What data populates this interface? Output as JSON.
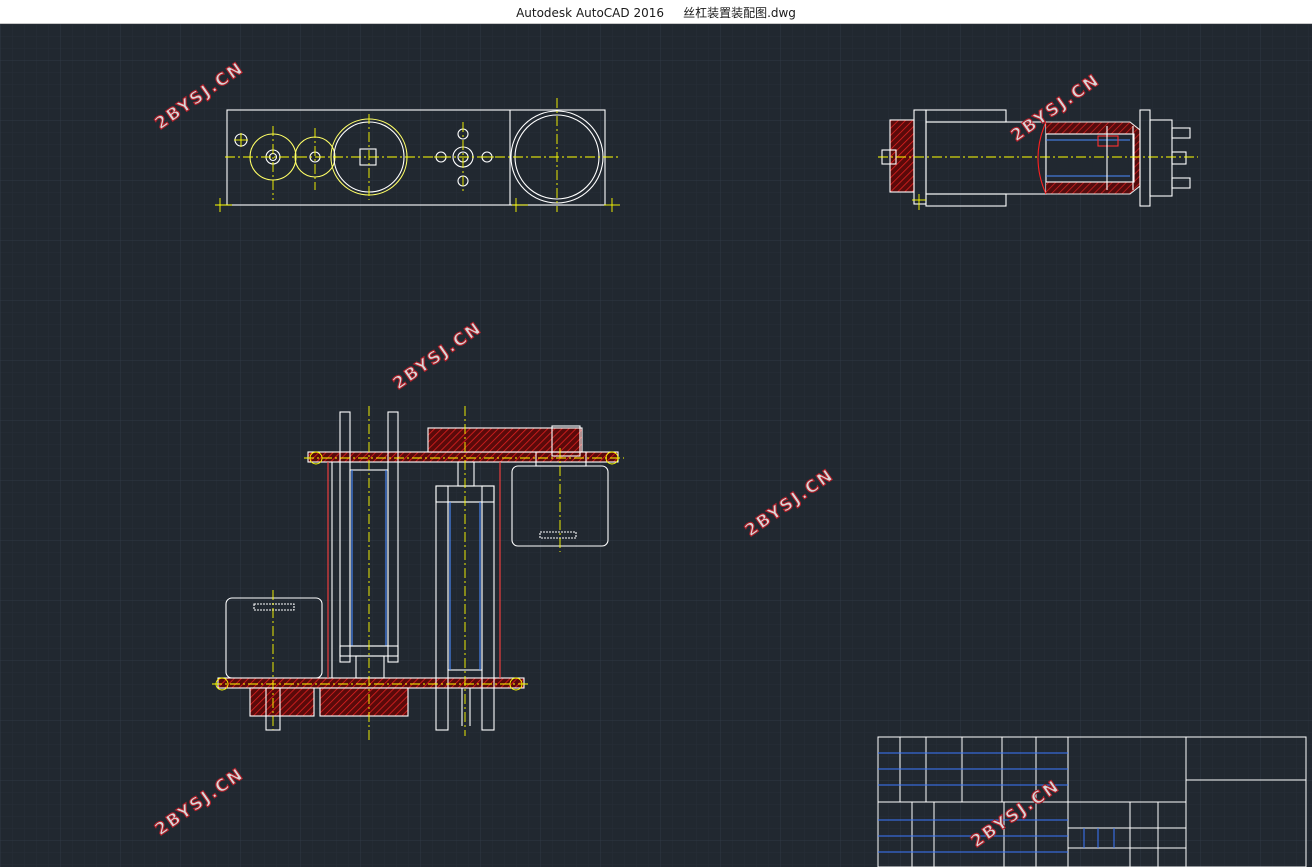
{
  "window": {
    "app_name": "Autodesk AutoCAD 2016",
    "file_name": "丝杠装置装配图.dwg"
  },
  "drawing": {
    "background": "#212830",
    "line_color": "#ffffff",
    "centerline_color": "#ffff00",
    "section_color": "#cc1111",
    "hidden_color": "#3a78ff",
    "grid_color": "#2d3641"
  },
  "watermark": {
    "text": "2BYSJ.CN"
  },
  "views": [
    {
      "name": "top-view"
    },
    {
      "name": "side-view"
    },
    {
      "name": "front-section-view"
    }
  ],
  "title_block": {
    "icon": "title-block-table"
  }
}
